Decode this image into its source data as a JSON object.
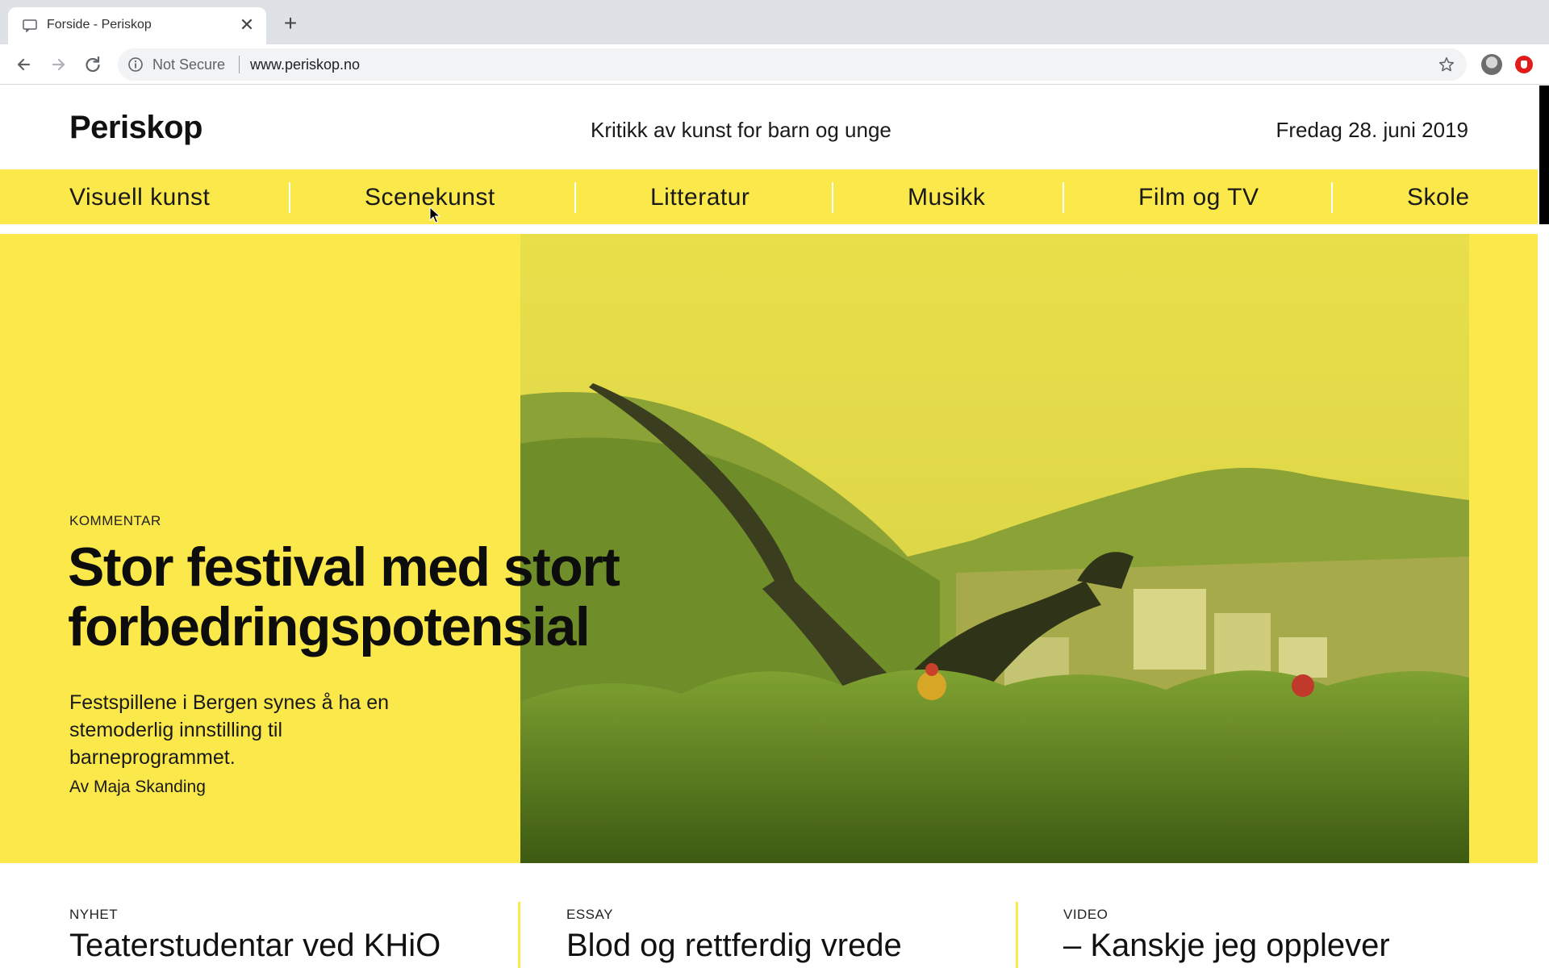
{
  "browser": {
    "tab_title": "Forside - Periskop",
    "close_glyph": "✕",
    "newtab_glyph": "+",
    "security_label": "Not Secure",
    "url": "www.periskop.no"
  },
  "site": {
    "logo": "Periskop",
    "tagline": "Kritikk av kunst for barn og unge",
    "date": "Fredag 28. juni 2019"
  },
  "nav": [
    {
      "label": "Visuell kunst"
    },
    {
      "label": "Scenekunst"
    },
    {
      "label": "Litteratur"
    },
    {
      "label": "Musikk"
    },
    {
      "label": "Film og TV"
    },
    {
      "label": "Skole"
    }
  ],
  "hero": {
    "label": "KOMMENTAR",
    "title": "Stor festival med stort forbedringspotensial",
    "lead": "Festspillene i Bergen synes å ha en stemoderlig innstilling til barneprogrammet.",
    "byline": "Av Maja Skanding"
  },
  "cards": [
    {
      "kicker": "NYHET",
      "headline": "Teaterstudentar ved KHiO"
    },
    {
      "kicker": "ESSAY",
      "headline": "Blod og rettferdig vrede"
    },
    {
      "kicker": "VIDEO",
      "headline": "– Kanskje jeg opplever"
    }
  ],
  "colors": {
    "brand_yellow": "#fbe84a",
    "text": "#111111"
  }
}
